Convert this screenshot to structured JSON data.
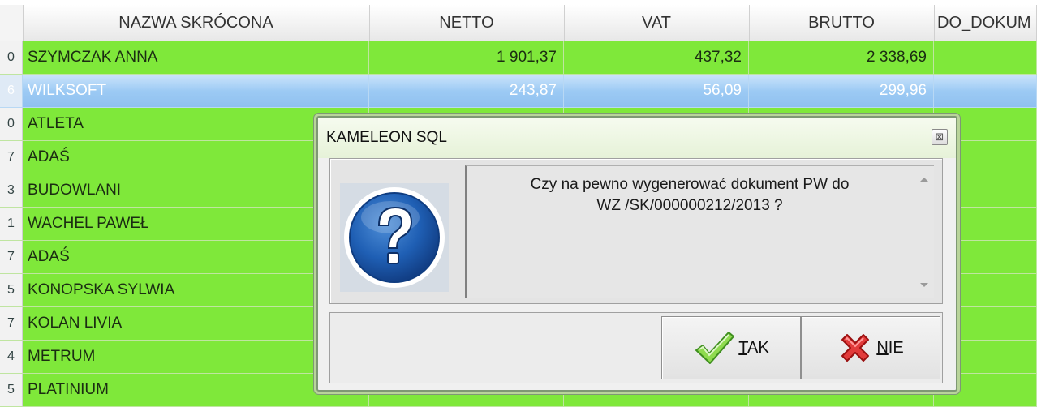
{
  "columns": {
    "name": "NAZWA SKRÓCONA",
    "netto": "NETTO",
    "vat": "VAT",
    "brutto": "BRUTTO",
    "do_dokum": "DO_DOKUM"
  },
  "rows": [
    {
      "idx": "0",
      "name": "SZYMCZAK ANNA",
      "netto": "1 901,37",
      "vat": "437,32",
      "brutto": "2 338,69",
      "selected": false
    },
    {
      "idx": "6",
      "name": "WILKSOFT",
      "netto": "243,87",
      "vat": "56,09",
      "brutto": "299,96",
      "selected": true
    },
    {
      "idx": "0",
      "name": "ATLETA",
      "netto": "",
      "vat": "",
      "brutto": "",
      "selected": false
    },
    {
      "idx": "7",
      "name": "ADAŚ",
      "netto": "",
      "vat": "",
      "brutto": "",
      "selected": false
    },
    {
      "idx": "3",
      "name": "BUDOWLANI",
      "netto": "",
      "vat": "",
      "brutto": "",
      "selected": false
    },
    {
      "idx": "1",
      "name": "WACHEL PAWEŁ",
      "netto": "",
      "vat": "",
      "brutto": "",
      "selected": false
    },
    {
      "idx": "7",
      "name": "ADAŚ",
      "netto": "",
      "vat": "",
      "brutto": "",
      "selected": false
    },
    {
      "idx": "5",
      "name": "KONOPSKA SYLWIA",
      "netto": "",
      "vat": "",
      "brutto": "",
      "selected": false
    },
    {
      "idx": "7",
      "name": "KOLAN LIVIA",
      "netto": "",
      "vat": "",
      "brutto": "",
      "selected": false
    },
    {
      "idx": "4",
      "name": "METRUM",
      "netto": "",
      "vat": "",
      "brutto": "",
      "selected": false
    },
    {
      "idx": "5",
      "name": "PLATINIUM",
      "netto": "",
      "vat": "",
      "brutto": "",
      "selected": false
    }
  ],
  "dialog": {
    "title": "KAMELEON SQL",
    "close_label": "⊠",
    "message_line1": "Czy na pewno wygenerować dokument PW do",
    "message_line2": "WZ /SK/000000212/2013 ?",
    "icon": "question-icon",
    "yes_accel": "T",
    "yes_rest": "AK",
    "no_accel": "N",
    "no_rest": "IE"
  },
  "colors": {
    "row_green": "#7fe83a",
    "row_selected": "#9ccaf4",
    "dialog_border": "#7e9874"
  }
}
